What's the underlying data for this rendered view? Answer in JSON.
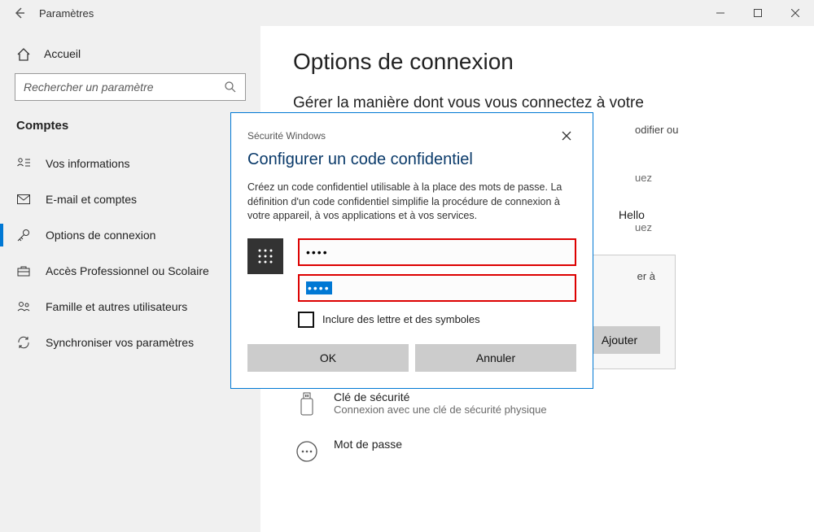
{
  "titlebar": {
    "title": "Paramètres"
  },
  "sidebar": {
    "home_label": "Accueil",
    "search_placeholder": "Rechercher un paramètre",
    "category": "Comptes",
    "items": [
      {
        "label": "Vos informations"
      },
      {
        "label": "E-mail et comptes"
      },
      {
        "label": "Options de connexion"
      },
      {
        "label": "Accès Professionnel ou Scolaire"
      },
      {
        "label": "Famille et autres utilisateurs"
      },
      {
        "label": "Synchroniser vos paramètres"
      }
    ]
  },
  "main": {
    "page_title": "Options de connexion",
    "section_heading": "Gérer la manière dont vous vous connectez à votre",
    "partial_right_1": "odifier ou",
    "partial_right_2": "uez",
    "hello_title": "Hello",
    "hello_sub": "uez",
    "panel_hint": "er à",
    "add_button": "Ajouter",
    "options": [
      {
        "title": "Clé de sécurité",
        "subtitle": "Connexion avec une clé de sécurité physique"
      },
      {
        "title": "Mot de passe",
        "subtitle": ""
      }
    ]
  },
  "modal": {
    "security_label": "Sécurité Windows",
    "title": "Configurer un code confidentiel",
    "body": "Créez un code confidentiel utilisable à la place des mots de passe. La définition d'un code confidentiel simplifie la procédure de connexion à votre appareil, à vos applications et à vos services.",
    "pin1_value": "••••",
    "pin2_value": "••••",
    "checkbox_label": "Inclure des lettre et des symboles",
    "ok_label": "OK",
    "cancel_label": "Annuler"
  }
}
